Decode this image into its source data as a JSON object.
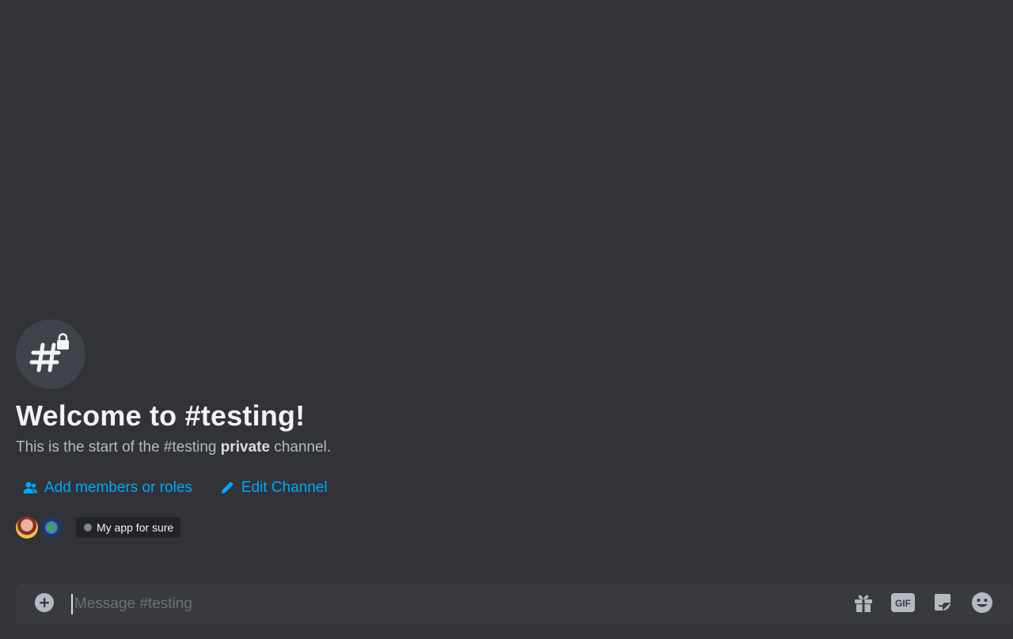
{
  "welcome": {
    "title": "Welcome to #testing!",
    "desc_prefix": "This is the start of the #testing ",
    "desc_bold": "private",
    "desc_suffix": " channel.",
    "channel_icon": "private-channel-hash-lock-icon"
  },
  "actions": {
    "add_members_label": "Add members or roles",
    "add_members_icon": "user-add-icon",
    "edit_channel_label": "Edit Channel",
    "edit_channel_icon": "pencil-icon"
  },
  "members": {
    "app_tag_label": "My app for sure"
  },
  "composer": {
    "placeholder": "Message #testing",
    "value": "",
    "attach_icon": "plus-circle-icon",
    "tools": [
      "gift-icon",
      "gif-icon",
      "sticker-icon",
      "emoji-icon"
    ],
    "gif_label": "GIF"
  },
  "colors": {
    "background": "#313338",
    "link": "#00a8fc",
    "composer_bg": "#383a40",
    "icon_gray": "#b5bac1"
  }
}
